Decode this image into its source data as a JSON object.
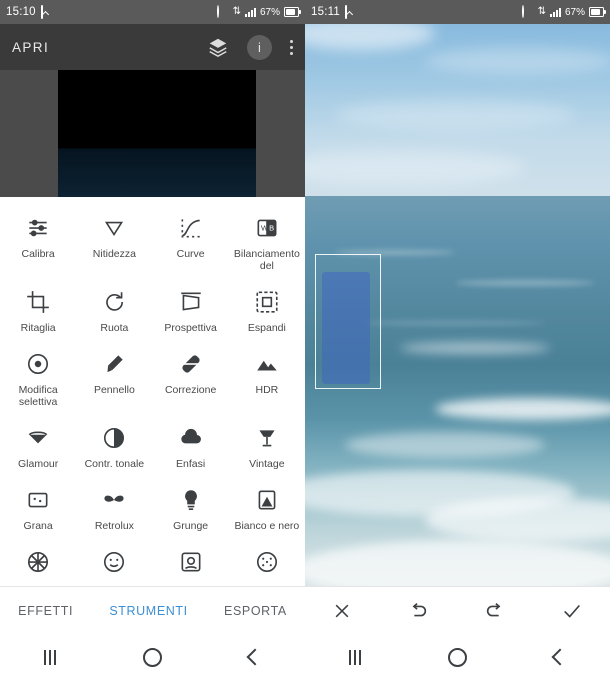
{
  "left": {
    "status": {
      "clock": "15:10",
      "icons": [
        "image-icon",
        "alarm-icon",
        "sync-icon",
        "signal-icon",
        "battery-icon"
      ],
      "battery": "67%"
    },
    "appbar": {
      "title": "APRI",
      "actions": [
        "layers-icon",
        "info-icon",
        "overflow-menu-icon"
      ]
    },
    "tools": [
      [
        {
          "label": "Calibra",
          "icon": "tune-icon"
        },
        {
          "label": "Nitidezza",
          "icon": "sharpen-icon"
        },
        {
          "label": "Curve",
          "icon": "curves-icon"
        },
        {
          "label": "Bilanciamento del",
          "icon": "white-balance-icon"
        }
      ],
      [
        {
          "label": "Ritaglia",
          "icon": "crop-icon"
        },
        {
          "label": "Ruota",
          "icon": "rotate-icon"
        },
        {
          "label": "Prospettiva",
          "icon": "perspective-icon"
        },
        {
          "label": "Espandi",
          "icon": "expand-icon"
        }
      ],
      [
        {
          "label": "Modifica selettiva",
          "icon": "selective-icon"
        },
        {
          "label": "Pennello",
          "icon": "brush-icon"
        },
        {
          "label": "Correzione",
          "icon": "healing-icon"
        },
        {
          "label": "HDR",
          "icon": "hdr-icon"
        }
      ],
      [
        {
          "label": "Glamour",
          "icon": "glamour-icon"
        },
        {
          "label": "Contr. tonale",
          "icon": "tonal-contrast-icon"
        },
        {
          "label": "Enfasi",
          "icon": "drama-icon"
        },
        {
          "label": "Vintage",
          "icon": "vintage-icon"
        }
      ],
      [
        {
          "label": "Grana",
          "icon": "grain-icon"
        },
        {
          "label": "Retrolux",
          "icon": "retrolux-icon"
        },
        {
          "label": "Grunge",
          "icon": "grunge-icon"
        },
        {
          "label": "Bianco e nero",
          "icon": "black-and-white-icon"
        }
      ],
      [
        {
          "label": "",
          "icon": "film-icon"
        },
        {
          "label": "",
          "icon": "face-icon"
        },
        {
          "label": "",
          "icon": "head-pose-icon"
        },
        {
          "label": "",
          "icon": "lens-blur-icon"
        }
      ]
    ],
    "tabs": [
      {
        "label": "EFFETTI",
        "active": false
      },
      {
        "label": "STRUMENTI",
        "active": true
      },
      {
        "label": "ESPORTA",
        "active": false
      }
    ],
    "nav": [
      "recents-icon",
      "home-icon",
      "back-icon"
    ]
  },
  "right": {
    "status": {
      "clock": "15:11",
      "icons": [
        "image-icon",
        "alarm-icon",
        "sync-icon",
        "signal-icon",
        "battery-icon"
      ],
      "battery": "67%"
    },
    "appbar": {
      "actions": [
        "compare-icon"
      ]
    },
    "toolbar": [
      "close-icon",
      "undo-icon",
      "redo-icon",
      "confirm-icon"
    ],
    "nav": [
      "recents-icon",
      "home-icon",
      "back-icon"
    ]
  },
  "colors": {
    "accent": "#3b8fd4",
    "statusbar": "#5a5a5a",
    "appbar": "#3a3a3a",
    "icon": "#3c4043",
    "label": "#4a4a4a"
  }
}
